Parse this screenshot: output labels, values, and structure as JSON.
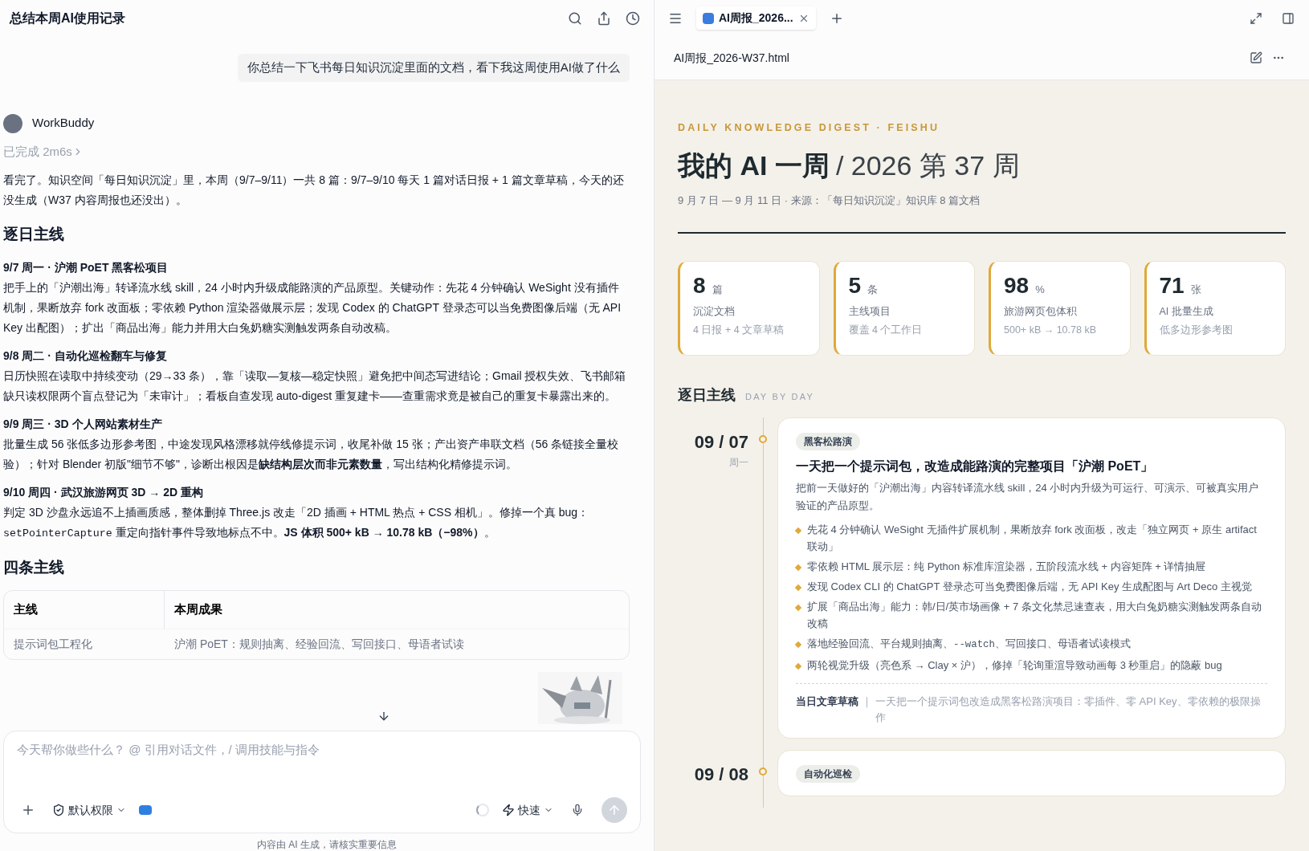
{
  "chat": {
    "title": "总结本周AI使用记录",
    "user_message": "你总结一下飞书每日知识沉淀里面的文档，看下我这周使用AI做了什么",
    "assistant": {
      "name": "WorkBuddy",
      "status": "已完成 2m6s"
    },
    "intro": "看完了。知识空间「每日知识沉淀」里，本周（9/7–9/11）一共 8 篇：9/7–9/10 每天 1 篇对话日报 + 1 篇文章草稿，今天的还没生成（W37 内容周报也还没出）。",
    "sections": [
      {
        "heading": "逐日主线",
        "items": [
          {
            "title": "9/7 周一 · 沪潮 PoET 黑客松项目",
            "body": [
              {
                "kind": "text",
                "text": "把手上的「沪潮出海」转译流水线 skill，24 小时内升级成能路演的产品原型。关键动作：先花 4 分钟确认 WeSight 没有插件机制，果断放弃 fork 改面板；零依赖 Python 渲染器做展示层；发现 Codex 的 ChatGPT 登录态可以当免费图像后端（无 API Key 出配图）；扩出「商品出海」能力并用大白兔奶糖实测触发两条自动改稿。"
              }
            ]
          },
          {
            "title": "9/8 周二 · 自动化巡检翻车与修复",
            "body": [
              {
                "kind": "text",
                "text": "日历快照在读取中持续变动（29→33 条），靠「读取—复核—稳定快照」避免把中间态写进结论；Gmail 授权失效、飞书邮箱缺只读权限两个盲点登记为「未审计」；看板自查发现 auto-digest 重复建卡——查重需求竟是被自己的重复卡暴露出来的。"
              }
            ]
          },
          {
            "title": "9/9 周三 · 3D 个人网站素材生产",
            "body": [
              {
                "kind": "text",
                "text": "批量生成 56 张低多边形参考图，中途发现风格漂移就停线修提示词，收尾补做 15 张；产出资产串联文档（56 条链接全量校验）；针对 Blender 初版\"细节不够\"，诊断出根因是**缺结构层次而非元素数量**，写出结构化精修提示词。"
              }
            ]
          },
          {
            "title": "9/10 周四 · 武汉旅游网页 3D → 2D 重构",
            "body": [
              {
                "kind": "text",
                "text": "判定 3D 沙盘永远追不上插画质感，整体删掉 Three.js 改走「2D 插画 + HTML 热点 + CSS 相机」。修掉一个真 bug："
              },
              {
                "kind": "code",
                "text": "setPointerCapture"
              },
              {
                "kind": "text",
                "text": " 重定向指针事件导致地标点不中。**JS 体积 500+ kB → 10.78 kB（−98%）**。"
              }
            ]
          }
        ]
      },
      {
        "heading": "四条主线",
        "table": {
          "columns": [
            "主线",
            "本周成果"
          ],
          "rows": [
            [
              "提示词包工程化",
              "沪潮 PoET：规则抽离、经验回流、写回接口、母语者试读"
            ]
          ]
        }
      }
    ],
    "input": {
      "placeholder": "今天帮你做些什么？ @ 引用对话文件，/ 调用技能与指令",
      "permission": "默认权限",
      "speed": "快速"
    },
    "footer": "内容由 AI 生成，请核实重要信息"
  },
  "preview": {
    "tabs": [
      {
        "label": "AI周报_2026...",
        "selected": true
      }
    ],
    "file_name": "AI周报_2026-W37.html",
    "kicker": "DAILY KNOWLEDGE DIGEST · FEISHU",
    "title": "我的 AI 一周",
    "title_suffix": "/ 2026 第 37 周",
    "subtitle": "9 月 7 日 — 9 月 11 日 · 来源：「每日知识沉淀」知识库 8 篇文档",
    "stats": [
      {
        "value": "8",
        "unit": "篇",
        "label": "沉淀文档",
        "detail": "4 日报 + 4 文章草稿"
      },
      {
        "value": "5",
        "unit": "条",
        "label": "主线项目",
        "detail": "覆盖 4 个工作日"
      },
      {
        "value": "98",
        "unit": "%",
        "label": "旅游网页包体积",
        "detail": "500+ kB → 10.78 kB"
      },
      {
        "value": "71",
        "unit": "张",
        "label": "AI 批量生成",
        "detail": "低多边形参考图"
      }
    ],
    "section_title": "逐日主线",
    "section_subtitle": "DAY BY DAY",
    "days": [
      {
        "date": "09 / 07",
        "weekday": "周一",
        "tag": "黑客松路演",
        "title": "一天把一个提示词包，改造成能路演的完整项目「沪潮 PoET」",
        "summary": "把前一天做好的「沪潮出海」内容转译流水线 skill，24 小时内升级为可运行、可演示、可被真实用户验证的产品原型。",
        "bullets": [
          [
            {
              "kind": "text",
              "text": "先花 4 分钟确认 WeSight 无插件扩展机制，果断放弃 fork 改面板，改走「独立网页 + 原生 artifact 联动」"
            }
          ],
          [
            {
              "kind": "text",
              "text": "零依赖 HTML 展示层：纯 Python 标准库渲染器，五阶段流水线 + 内容矩阵 + 详情抽屉"
            }
          ],
          [
            {
              "kind": "text",
              "text": "发现 Codex CLI 的 ChatGPT 登录态可当免费图像后端，无 API Key 生成配图与 Art Deco 主视觉"
            }
          ],
          [
            {
              "kind": "text",
              "text": "扩展「商品出海」能力：韩/日/英市场画像 + 7 条文化禁忌速查表，用大白兔奶糖实测触发两条自动改稿"
            }
          ],
          [
            {
              "kind": "text",
              "text": "落地经验回流、平台规则抽离、"
            },
            {
              "kind": "code",
              "text": "--watch"
            },
            {
              "kind": "text",
              "text": "、写回接口、母语者试读模式"
            }
          ],
          [
            {
              "kind": "text",
              "text": "两轮视觉升级（亮色系 → Clay × 沪），修掉「轮询重渲导致动画每 3 秒重启」的隐蔽 bug"
            }
          ]
        ],
        "draft_label": "当日文章草稿",
        "draft_separator": "｜",
        "draft_text": "一天把一个提示词包改造成黑客松路演项目：零插件、零 API Key、零依赖的极限操作"
      },
      {
        "date": "09 / 08",
        "tag": "自动化巡检"
      }
    ]
  }
}
